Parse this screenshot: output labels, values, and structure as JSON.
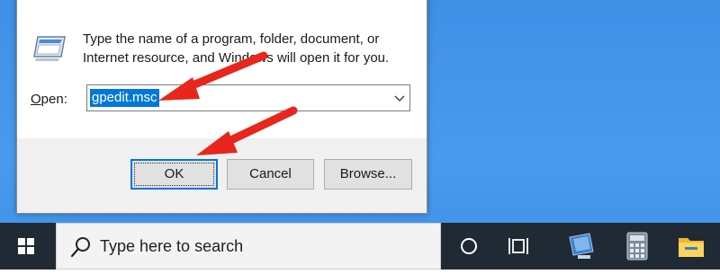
{
  "run_dialog": {
    "description": "Type the name of a program, folder, document, or Internet resource, and Windows will open it for you.",
    "open_label_prefix": "O",
    "open_label_rest": "pen:",
    "open_value": "gpedit.msc",
    "ok_label": "OK",
    "cancel_label": "Cancel",
    "browse_label": "Browse..."
  },
  "taskbar": {
    "search_placeholder": "Type here to search",
    "icons": [
      "windows-start-icon",
      "search-icon",
      "cortana-icon",
      "task-view-icon",
      "remote-desktop-icon",
      "calculator-icon",
      "file-explorer-icon"
    ]
  },
  "colors": {
    "desktop": "#4a9bef",
    "taskbar": "#202a34",
    "selection": "#0078d7",
    "arrow": "#e8261c"
  }
}
